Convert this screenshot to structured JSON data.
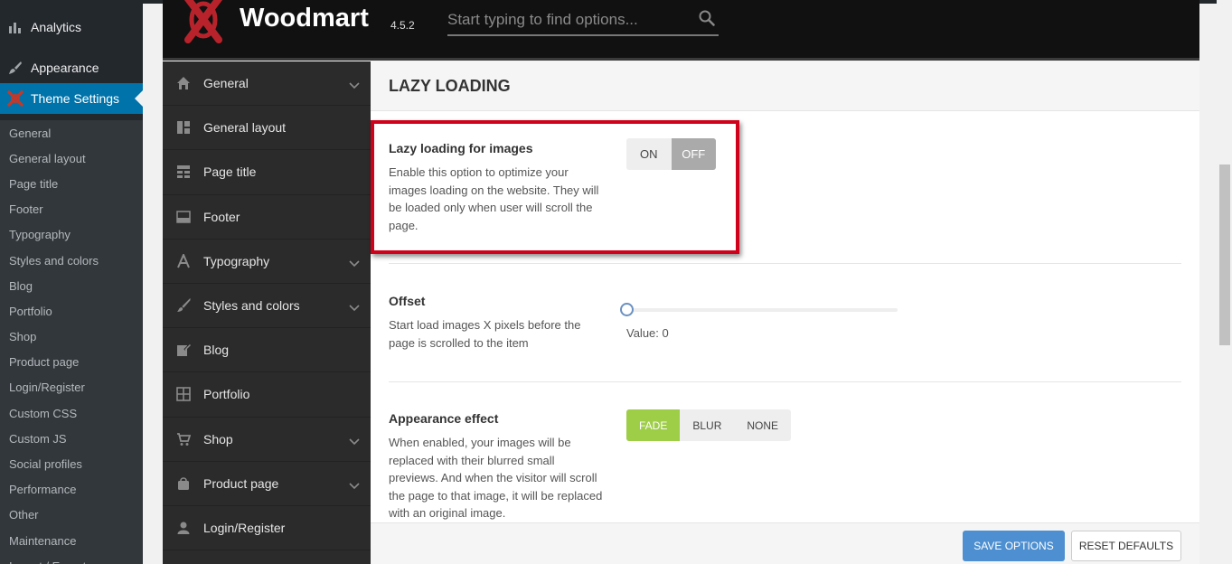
{
  "wp_menu": {
    "analytics": "Analytics",
    "appearance": "Appearance",
    "theme_settings": "Theme Settings",
    "submenu": [
      "General",
      "General layout",
      "Page title",
      "Footer",
      "Typography",
      "Styles and colors",
      "Blog",
      "Portfolio",
      "Shop",
      "Product page",
      "Login/Register",
      "Custom CSS",
      "Custom JS",
      "Social profiles",
      "Performance",
      "Other",
      "Maintenance",
      "Import / Export"
    ]
  },
  "header": {
    "logo": "Woodmart",
    "version": "4.5.2",
    "search_placeholder": "Start typing to find options..."
  },
  "options_nav": [
    {
      "label": "General",
      "icon": "home-icon",
      "expandable": true
    },
    {
      "label": "General layout",
      "icon": "layout-icon",
      "expandable": false
    },
    {
      "label": "Page title",
      "icon": "page-title-icon",
      "expandable": false
    },
    {
      "label": "Footer",
      "icon": "footer-icon",
      "expandable": false
    },
    {
      "label": "Typography",
      "icon": "typography-icon",
      "expandable": true
    },
    {
      "label": "Styles and colors",
      "icon": "brush-icon",
      "expandable": true
    },
    {
      "label": "Blog",
      "icon": "edit-icon",
      "expandable": false
    },
    {
      "label": "Portfolio",
      "icon": "grid-icon",
      "expandable": false
    },
    {
      "label": "Shop",
      "icon": "cart-icon",
      "expandable": true
    },
    {
      "label": "Product page",
      "icon": "bag-icon",
      "expandable": true
    },
    {
      "label": "Login/Register",
      "icon": "user-icon",
      "expandable": false
    }
  ],
  "section": {
    "title": "LAZY LOADING",
    "lazy": {
      "title": "Lazy loading for images",
      "desc": "Enable this option to optimize your images loading on the website. They will be loaded only when user will scroll the page.",
      "on": "ON",
      "off": "OFF",
      "value": "OFF"
    },
    "offset": {
      "title": "Offset",
      "desc": "Start load images X pixels before the page is scrolled to the item",
      "value_label": "Value: 0",
      "value": 0
    },
    "effect": {
      "title": "Appearance effect",
      "desc": "When enabled, your images will be replaced with their blurred small previews. And when the visitor will scroll the page to that image, it will be replaced with an original image.",
      "options": [
        "FADE",
        "BLUR",
        "NONE"
      ],
      "selected": "FADE"
    }
  },
  "footer": {
    "save": "SAVE OPTIONS",
    "reset": "RESET DEFAULTS"
  },
  "colors": {
    "wp_accent": "#0073aa",
    "save_button": "#4d8fd1",
    "active_segment": "#9ecd48",
    "highlight_border": "#d0021b"
  }
}
